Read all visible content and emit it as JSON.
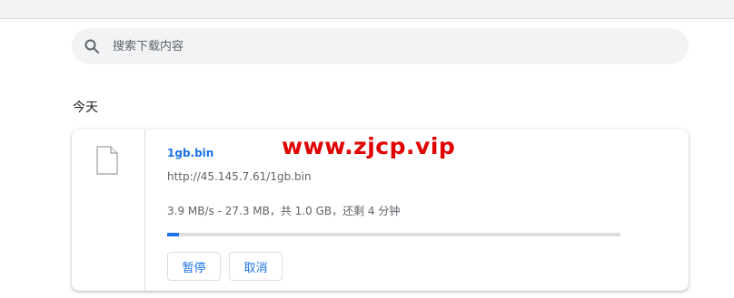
{
  "search": {
    "placeholder": "搜索下载内容",
    "value": ""
  },
  "section": {
    "title": "今天"
  },
  "download": {
    "filename": "1gb.bin",
    "url": "http://45.145.7.61/1gb.bin",
    "status": "3.9 MB/s - 27.3 MB，共 1.0 GB，还剩 4 分钟",
    "progress_fraction": 0.027,
    "pause_label": "暂停",
    "cancel_label": "取消"
  },
  "watermark": {
    "text": "www.zjcp.vip"
  },
  "colors": {
    "accent": "#1a73e8",
    "watermark": "#e00000",
    "track": "#dadce0"
  },
  "icons": {
    "search": "search-icon",
    "file": "file-icon"
  }
}
